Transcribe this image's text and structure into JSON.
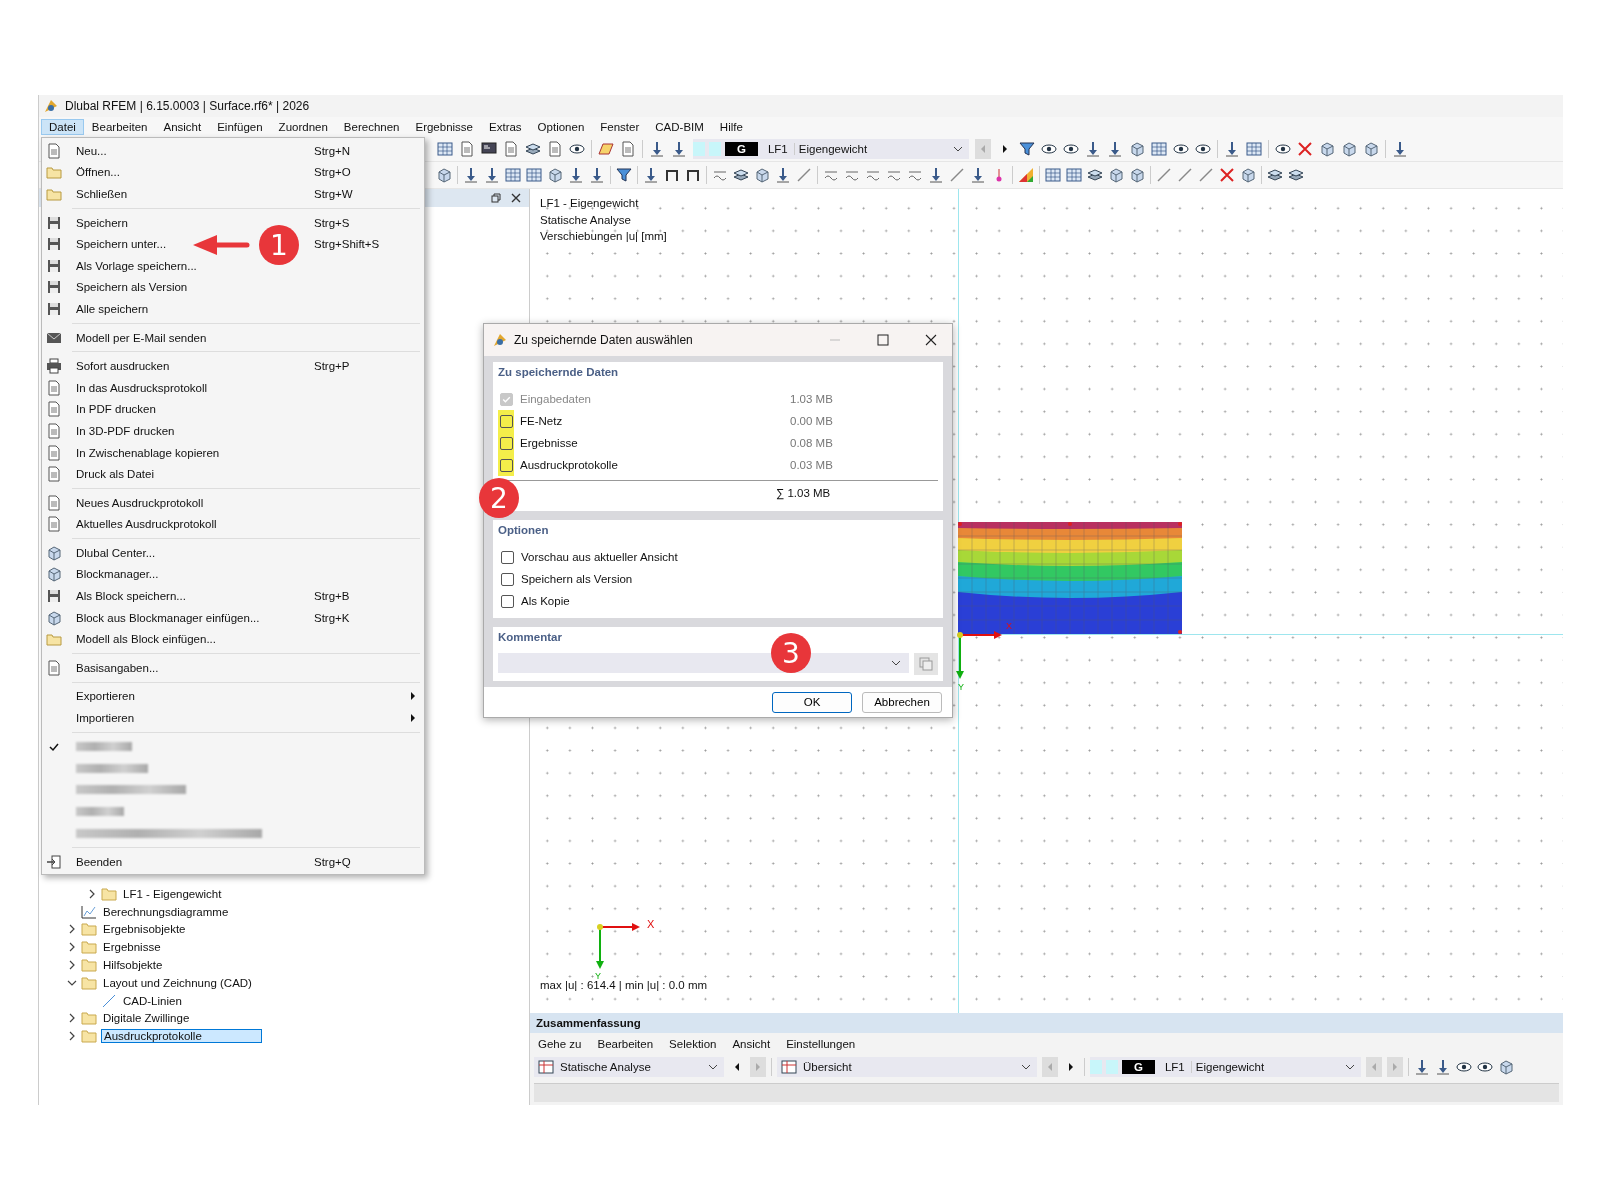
{
  "window": {
    "title": "Dlubal RFEM | 6.15.0003 | Surface.rf6* | 2026"
  },
  "menubar": [
    {
      "label": "Datei",
      "selected": true
    },
    {
      "label": "Bearbeiten",
      "selected": false
    },
    {
      "label": "Ansicht",
      "selected": false
    },
    {
      "label": "Einfügen",
      "selected": false
    },
    {
      "label": "Zuordnen",
      "selected": false
    },
    {
      "label": "Berechnen",
      "selected": false
    },
    {
      "label": "Ergebnisse",
      "selected": false
    },
    {
      "label": "Extras",
      "selected": false
    },
    {
      "label": "Optionen",
      "selected": false
    },
    {
      "label": "Fenster",
      "selected": false
    },
    {
      "label": "CAD-BIM",
      "selected": false
    },
    {
      "label": "Hilfe",
      "selected": false
    }
  ],
  "toolbar": {
    "load_case": {
      "group": "G",
      "number": "LF1",
      "name": "Eigengewicht"
    }
  },
  "menu": {
    "sections": [
      [
        {
          "label": "Neu...",
          "shortcut": "Strg+N",
          "kind": "action"
        },
        {
          "label": "Öffnen...",
          "shortcut": "Strg+O",
          "kind": "action"
        },
        {
          "label": "Schließen",
          "shortcut": "Strg+W",
          "kind": "action"
        }
      ],
      [
        {
          "label": "Speichern",
          "shortcut": "Strg+S",
          "kind": "action"
        },
        {
          "label": "Speichern unter...",
          "shortcut": "Strg+Shift+S",
          "kind": "action"
        },
        {
          "label": "Als Vorlage speichern...",
          "kind": "action"
        },
        {
          "label": "Speichern als Version",
          "kind": "action"
        },
        {
          "label": "Alle speichern",
          "kind": "action"
        }
      ],
      [
        {
          "label": "Modell per E-Mail senden",
          "kind": "action"
        }
      ],
      [
        {
          "label": "Sofort ausdrucken",
          "shortcut": "Strg+P",
          "kind": "action"
        },
        {
          "label": "In das Ausdrucksprotokoll",
          "kind": "action"
        },
        {
          "label": "In PDF drucken",
          "kind": "action"
        },
        {
          "label": "In 3D-PDF drucken",
          "kind": "action"
        },
        {
          "label": "In Zwischenablage kopieren",
          "kind": "action"
        },
        {
          "label": "Druck als Datei",
          "kind": "action"
        }
      ],
      [
        {
          "label": "Neues Ausdruckprotokoll",
          "kind": "action"
        },
        {
          "label": "Aktuelles Ausdruckprotokoll",
          "kind": "action"
        }
      ],
      [
        {
          "label": "Dlubal Center...",
          "kind": "action"
        },
        {
          "label": "Blockmanager...",
          "kind": "action"
        },
        {
          "label": "Als Block speichern...",
          "shortcut": "Strg+B",
          "kind": "action"
        },
        {
          "label": "Block aus Blockmanager einfügen...",
          "shortcut": "Strg+K",
          "kind": "action"
        },
        {
          "label": "Modell als Block einfügen...",
          "kind": "action"
        }
      ],
      [
        {
          "label": "Basisangaben...",
          "kind": "action"
        }
      ],
      [
        {
          "label": "Exportieren",
          "kind": "submenu"
        },
        {
          "label": "Importieren",
          "kind": "submenu"
        }
      ],
      [
        {
          "kind": "recent",
          "checked": true
        },
        {
          "kind": "recent",
          "checked": false
        },
        {
          "kind": "recent",
          "checked": false
        },
        {
          "kind": "recent",
          "checked": false
        },
        {
          "kind": "recent",
          "checked": false
        }
      ],
      [
        {
          "label": "Beenden",
          "shortcut": "Strg+Q",
          "kind": "action"
        }
      ]
    ]
  },
  "tree": [
    {
      "children": [
        {
          "label": "LF1 - Eigengewicht",
          "kind": "folder",
          "expanded": false,
          "selected": false
        }
      ]
    },
    {
      "label": "Berechnungsdiagramme",
      "kind": "diagram",
      "selected": false
    },
    {
      "label": "Ergebnisobjekte",
      "kind": "folder",
      "expanded": false,
      "selected": false
    },
    {
      "label": "Ergebnisse",
      "kind": "folder",
      "expanded": false,
      "selected": false
    },
    {
      "label": "Hilfsobjekte",
      "kind": "folder",
      "expanded": false,
      "selected": false
    },
    {
      "label": "Layout und Zeichnung (CAD)",
      "kind": "folder",
      "expanded": true,
      "selected": false,
      "children": [
        {
          "label": "CAD-Linien",
          "kind": "line",
          "selected": false
        }
      ]
    },
    {
      "label": "Digitale Zwillinge",
      "kind": "folder",
      "expanded": false,
      "selected": false
    },
    {
      "label": "Ausdruckprotokolle",
      "kind": "folder",
      "expanded": false,
      "selected": true
    }
  ],
  "view": {
    "info_lines": [
      "LF1 - Eigengewicht",
      "Statische Analyse",
      "Verschiebungen |u| [mm]"
    ],
    "surface_axes": {
      "x": "X",
      "y": "Y"
    },
    "global_axes": {
      "x": "X",
      "y": "Y"
    },
    "extremes": "max |u| : 614.4 | min |u| : 0.0 mm"
  },
  "summary": {
    "title": "Zusammenfassung",
    "menu": [
      "Gehe zu",
      "Bearbeiten",
      "Selektion",
      "Ansicht",
      "Einstellungen"
    ],
    "analysis": "Statische Analyse",
    "view": "Übersicht",
    "load_case": {
      "group": "G",
      "number": "LF1",
      "name": "Eigengewicht"
    }
  },
  "dialog": {
    "title": "Zu speichernde Daten auswählen",
    "data_heading": "Zu speichernde Daten",
    "data_rows": [
      {
        "label": "Eingabedaten",
        "size": "1.03 MB",
        "checked": true,
        "disabled": true,
        "highlighted": false
      },
      {
        "label": "FE-Netz",
        "size": "0.00 MB",
        "checked": false,
        "disabled": false,
        "highlighted": true
      },
      {
        "label": "Ergebnisse",
        "size": "0.08 MB",
        "checked": false,
        "disabled": false,
        "highlighted": true
      },
      {
        "label": "Ausdruckprotokolle",
        "size": "0.03 MB",
        "checked": false,
        "disabled": false,
        "highlighted": true
      }
    ],
    "total": "∑ 1.03 MB",
    "options_heading": "Optionen",
    "options": [
      {
        "label": "Vorschau aus aktueller Ansicht",
        "checked": false
      },
      {
        "label": "Speichern als Version",
        "checked": false
      },
      {
        "label": "Als Kopie",
        "checked": false
      }
    ],
    "comment_heading": "Kommentar",
    "buttons": [
      {
        "label": "OK",
        "default": true
      },
      {
        "label": "Abbrechen",
        "default": false
      }
    ]
  },
  "callouts": [
    {
      "number": "1",
      "kind": "arrow"
    },
    {
      "number": "2",
      "kind": "plain"
    },
    {
      "number": "3",
      "kind": "plain"
    }
  ]
}
